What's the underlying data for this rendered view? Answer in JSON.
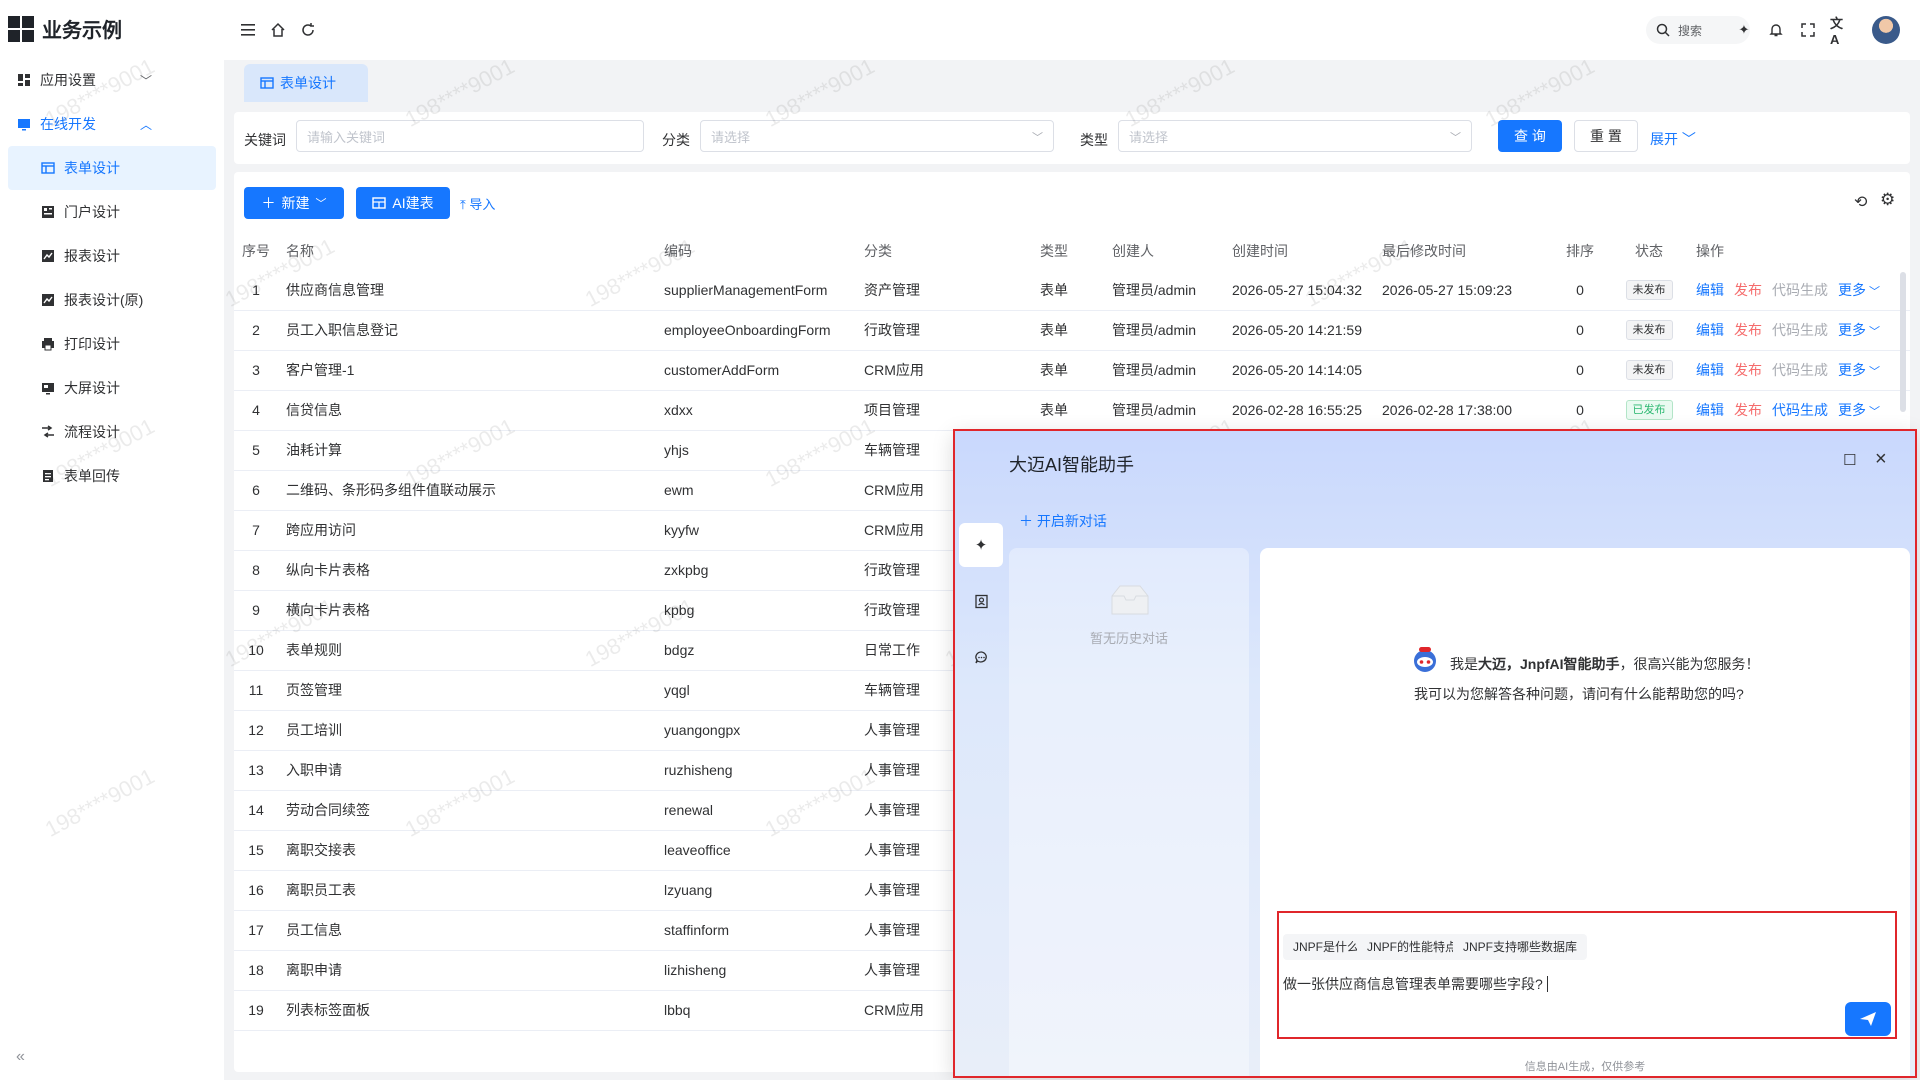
{
  "app": {
    "title": "业务示例"
  },
  "sidebar": {
    "items": [
      {
        "label": "应用设置",
        "icon": "dashboard-icon",
        "level": 1,
        "arrow": "down"
      },
      {
        "label": "在线开发",
        "icon": "monitor-icon",
        "level": 1,
        "arrow": "up",
        "expanded": true
      },
      {
        "label": "表单设计",
        "icon": "form-icon",
        "level": 2,
        "active": true
      },
      {
        "label": "门户设计",
        "icon": "portal-icon",
        "level": 2
      },
      {
        "label": "报表设计",
        "icon": "chart-icon",
        "level": 2
      },
      {
        "label": "报表设计(原)",
        "icon": "chart-icon",
        "level": 2
      },
      {
        "label": "打印设计",
        "icon": "printer-icon",
        "level": 2
      },
      {
        "label": "大屏设计",
        "icon": "screen-icon",
        "level": 2
      },
      {
        "label": "流程设计",
        "icon": "flow-icon",
        "level": 2
      },
      {
        "label": "表单回传",
        "icon": "document-icon",
        "level": 2
      }
    ],
    "collapse_label": "«"
  },
  "header": {
    "search_label": "搜索"
  },
  "tabs": [
    {
      "label": "表单设计"
    }
  ],
  "filter": {
    "keyword_label": "关键词",
    "keyword_placeholder": "请输入关键词",
    "category_label": "分类",
    "category_placeholder": "请选择",
    "type_label": "类型",
    "type_placeholder": "请选择",
    "query_label": "查 询",
    "reset_label": "重 置",
    "expand_label": "展开"
  },
  "toolbar": {
    "new_label": "新建",
    "ai_label": "AI建表",
    "import_label": "导入"
  },
  "table": {
    "columns": [
      "序号",
      "名称",
      "编码",
      "分类",
      "类型",
      "创建人",
      "创建时间",
      "最后修改时间",
      "排序",
      "状态",
      "操作"
    ],
    "rows": [
      {
        "no": "1",
        "name": "供应商信息管理",
        "code": "supplierManagementForm",
        "category": "资产管理",
        "type": "表单",
        "creator": "管理员/admin",
        "created": "2026-05-27 15:04:32",
        "modified": "2026-05-27 15:09:23",
        "sort": "0",
        "status": "未发布",
        "published": false
      },
      {
        "no": "2",
        "name": "员工入职信息登记",
        "code": "employeeOnboardingForm",
        "category": "行政管理",
        "type": "表单",
        "creator": "管理员/admin",
        "created": "2026-05-20 14:21:59",
        "modified": "",
        "sort": "0",
        "status": "未发布",
        "published": false
      },
      {
        "no": "3",
        "name": "客户管理-1",
        "code": "customerAddForm",
        "category": "CRM应用",
        "type": "表单",
        "creator": "管理员/admin",
        "created": "2026-05-20 14:14:05",
        "modified": "",
        "sort": "0",
        "status": "未发布",
        "published": false
      },
      {
        "no": "4",
        "name": "信贷信息",
        "code": "xdxx",
        "category": "项目管理",
        "type": "表单",
        "creator": "管理员/admin",
        "created": "2026-02-28 16:55:25",
        "modified": "2026-02-28 17:38:00",
        "sort": "0",
        "status": "已发布",
        "published": true
      },
      {
        "no": "5",
        "name": "油耗计算",
        "code": "yhjs",
        "category": "车辆管理"
      },
      {
        "no": "6",
        "name": "二维码、条形码多组件值联动展示",
        "code": "ewm",
        "category": "CRM应用"
      },
      {
        "no": "7",
        "name": "跨应用访问",
        "code": "kyyfw",
        "category": "CRM应用"
      },
      {
        "no": "8",
        "name": "纵向卡片表格",
        "code": "zxkpbg",
        "category": "行政管理"
      },
      {
        "no": "9",
        "name": "横向卡片表格",
        "code": "kpbg",
        "category": "行政管理"
      },
      {
        "no": "10",
        "name": "表单规则",
        "code": "bdgz",
        "category": "日常工作"
      },
      {
        "no": "11",
        "name": "页签管理",
        "code": "yqgl",
        "category": "车辆管理"
      },
      {
        "no": "12",
        "name": "员工培训",
        "code": "yuangongpx",
        "category": "人事管理"
      },
      {
        "no": "13",
        "name": "入职申请",
        "code": "ruzhisheng",
        "category": "人事管理"
      },
      {
        "no": "14",
        "name": "劳动合同续签",
        "code": "renewal",
        "category": "人事管理"
      },
      {
        "no": "15",
        "name": "离职交接表",
        "code": "leaveoffice",
        "category": "人事管理"
      },
      {
        "no": "16",
        "name": "离职员工表",
        "code": "lzyuang",
        "category": "人事管理"
      },
      {
        "no": "17",
        "name": "员工信息",
        "code": "staffinform",
        "category": "人事管理"
      },
      {
        "no": "18",
        "name": "离职申请",
        "code": "lizhisheng",
        "category": "人事管理"
      },
      {
        "no": "19",
        "name": "列表标签面板",
        "code": "lbbq",
        "category": "CRM应用"
      }
    ],
    "ops": {
      "edit": "编辑",
      "publish": "发布",
      "codegen": "代码生成",
      "more": "更多"
    }
  },
  "ai": {
    "title": "大迈AI智能助手",
    "new_conversation": "开启新对话",
    "no_history": "暂无历史对话",
    "greeting_prefix": "我是",
    "greeting_name": "大迈，JnpfAI智能助手",
    "greeting_suffix": "，很高兴能为您服务！",
    "greeting_line2": "我可以为您解答各种问题，请问有什么能帮助您的吗?",
    "suggestions": [
      "JNPF是什么",
      "JNPF的性能特点",
      "JNPF支持哪些数据库"
    ],
    "input_value": "做一张供应商信息管理表单需要哪些字段?",
    "disclaimer": "信息由AI生成，仅供参考"
  },
  "watermark": "198****9001",
  "colors": {
    "accent": "#1677ff",
    "danger": "#f56c6c",
    "success": "#2eb872",
    "highlight": "#e0262b"
  }
}
